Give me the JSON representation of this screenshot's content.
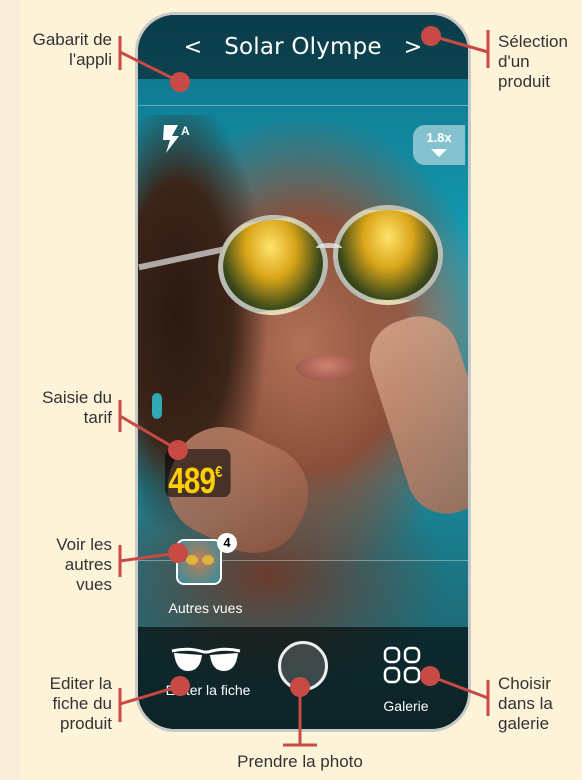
{
  "app": {
    "title": "Solar Olympe",
    "prev_icon": "chevron-left-icon",
    "next_icon": "chevron-right-icon",
    "flash_icon": "flash-auto-icon",
    "flash_badge": "A",
    "zoom_label": "1.8x",
    "price_value": "489",
    "price_currency": "€",
    "views_count": "4",
    "views_label": "Autres vues",
    "edit_label": "Editer la fiche",
    "gallery_label": "Galerie"
  },
  "annotations": {
    "gabarit": "Gabarit de l'appli",
    "selection": "Sélection d'un produit",
    "tarif": "Saisie du tarif",
    "vues": "Voir les autres vues",
    "editer": "Editer la fiche du produit",
    "galerie": "Choisir dans la galerie",
    "photo": "Prendre la photo"
  },
  "colors": {
    "callout": "#c74a45",
    "price": "#ffcf00",
    "background": "#fdf3d8"
  }
}
